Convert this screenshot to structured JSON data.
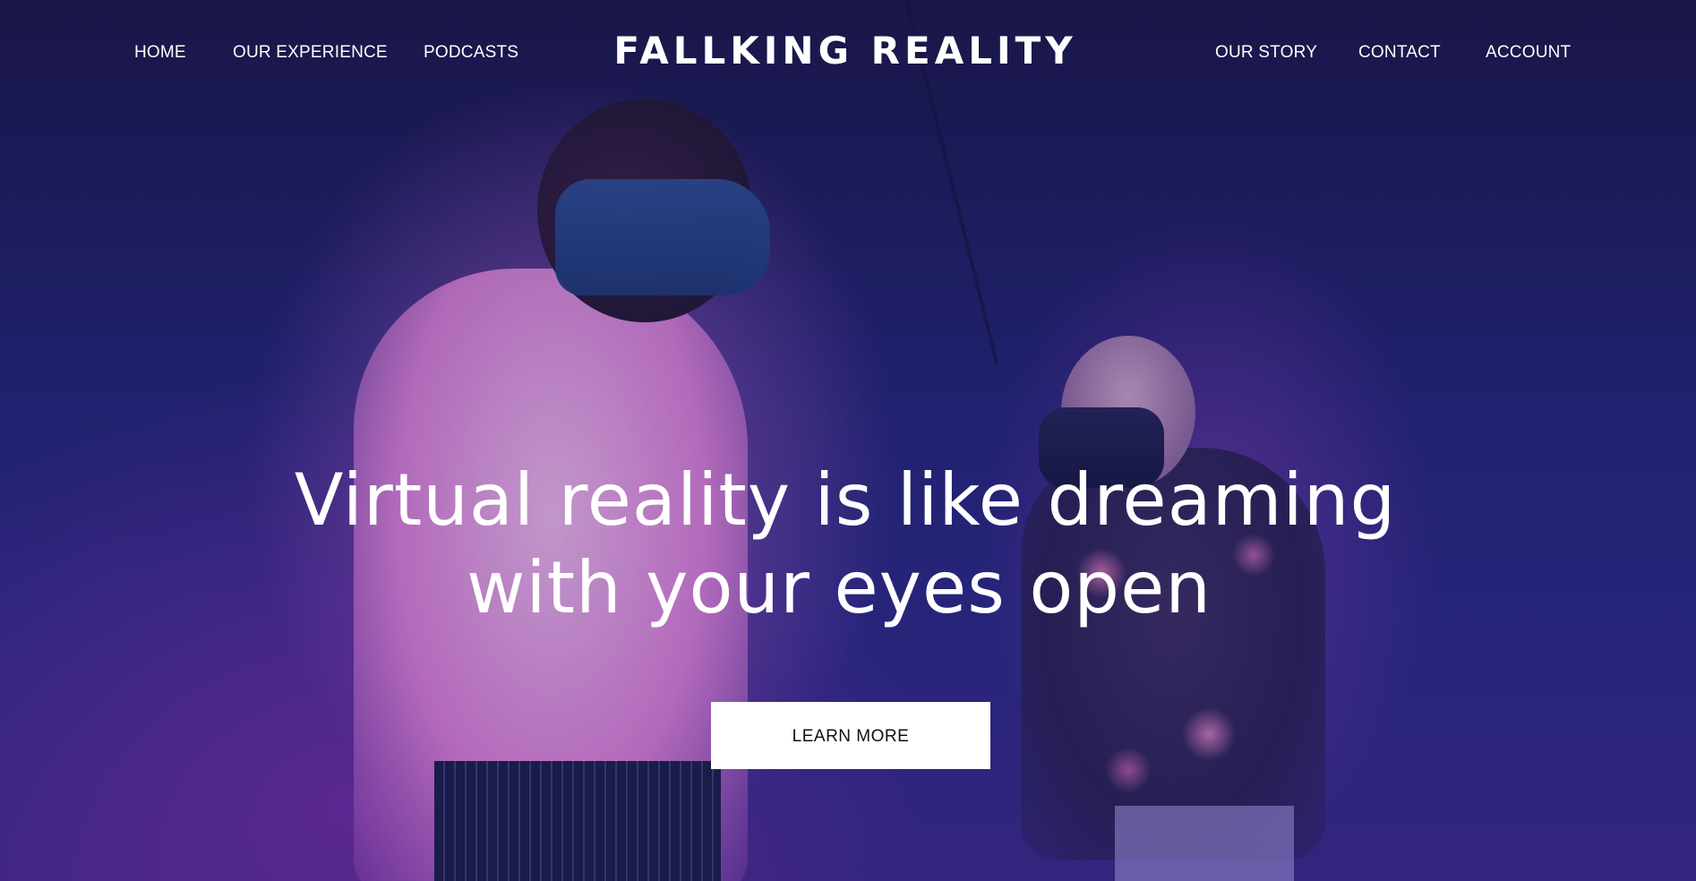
{
  "nav": {
    "left": [
      {
        "label": "HOME"
      },
      {
        "label": "OUR EXPERIENCE"
      },
      {
        "label": "PODCASTS"
      }
    ],
    "brand": "FALLKING REALITY",
    "right": [
      {
        "label": "OUR STORY"
      },
      {
        "label": "CONTACT"
      },
      {
        "label": "ACCOUNT"
      }
    ]
  },
  "hero": {
    "headline_line1": "Virtual reality is like dreaming",
    "headline_line2": "with your eyes open",
    "cta_label": "LEARN MORE"
  },
  "colors": {
    "background": "#2b2a86",
    "accent_pink": "#e98ade",
    "text": "#ffffff",
    "button_bg": "#ffffff",
    "button_text": "#111111"
  }
}
